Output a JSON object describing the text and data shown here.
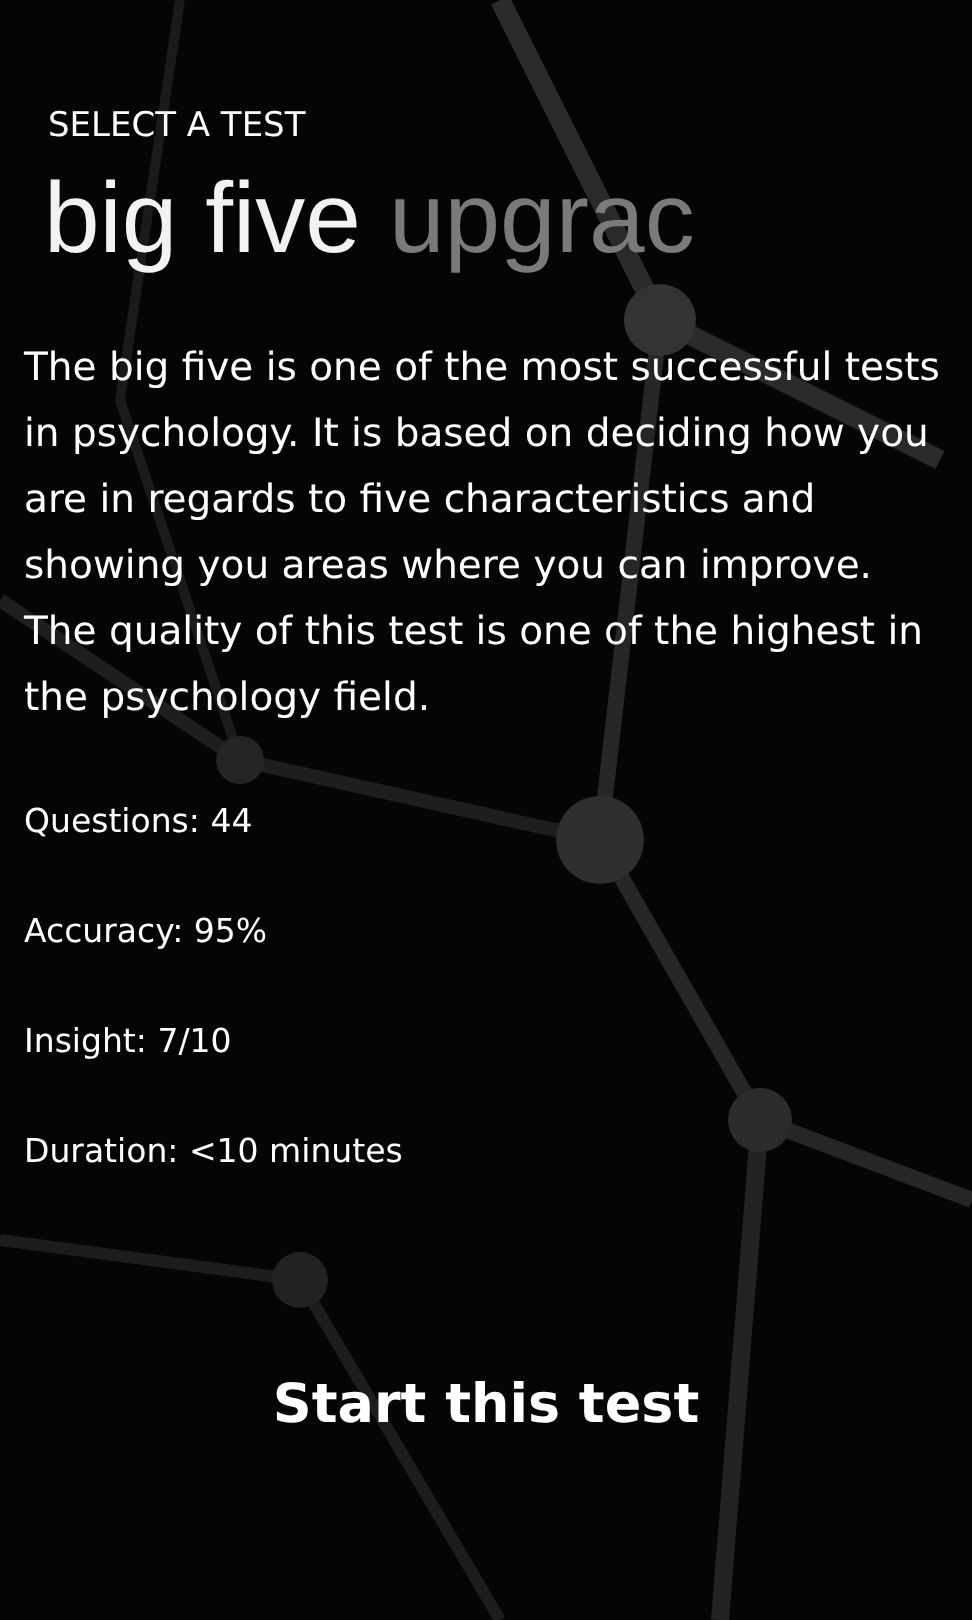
{
  "title": "SELECT A TEST",
  "pivot": [
    {
      "label": "big five",
      "selected": true
    },
    {
      "label": "upgrac",
      "selected": false
    }
  ],
  "description": "The big five is one of the most successful tests in psychology. It is based on deciding how you are in regards to five characteristics and showing you areas where you can improve.  The quality of this test is one of the highest in the psychology field.",
  "stats": [
    "Questions: 44",
    "Accuracy: 95%",
    "Insight: 7/10",
    "Duration: <10 minutes"
  ],
  "button": "Start this test"
}
